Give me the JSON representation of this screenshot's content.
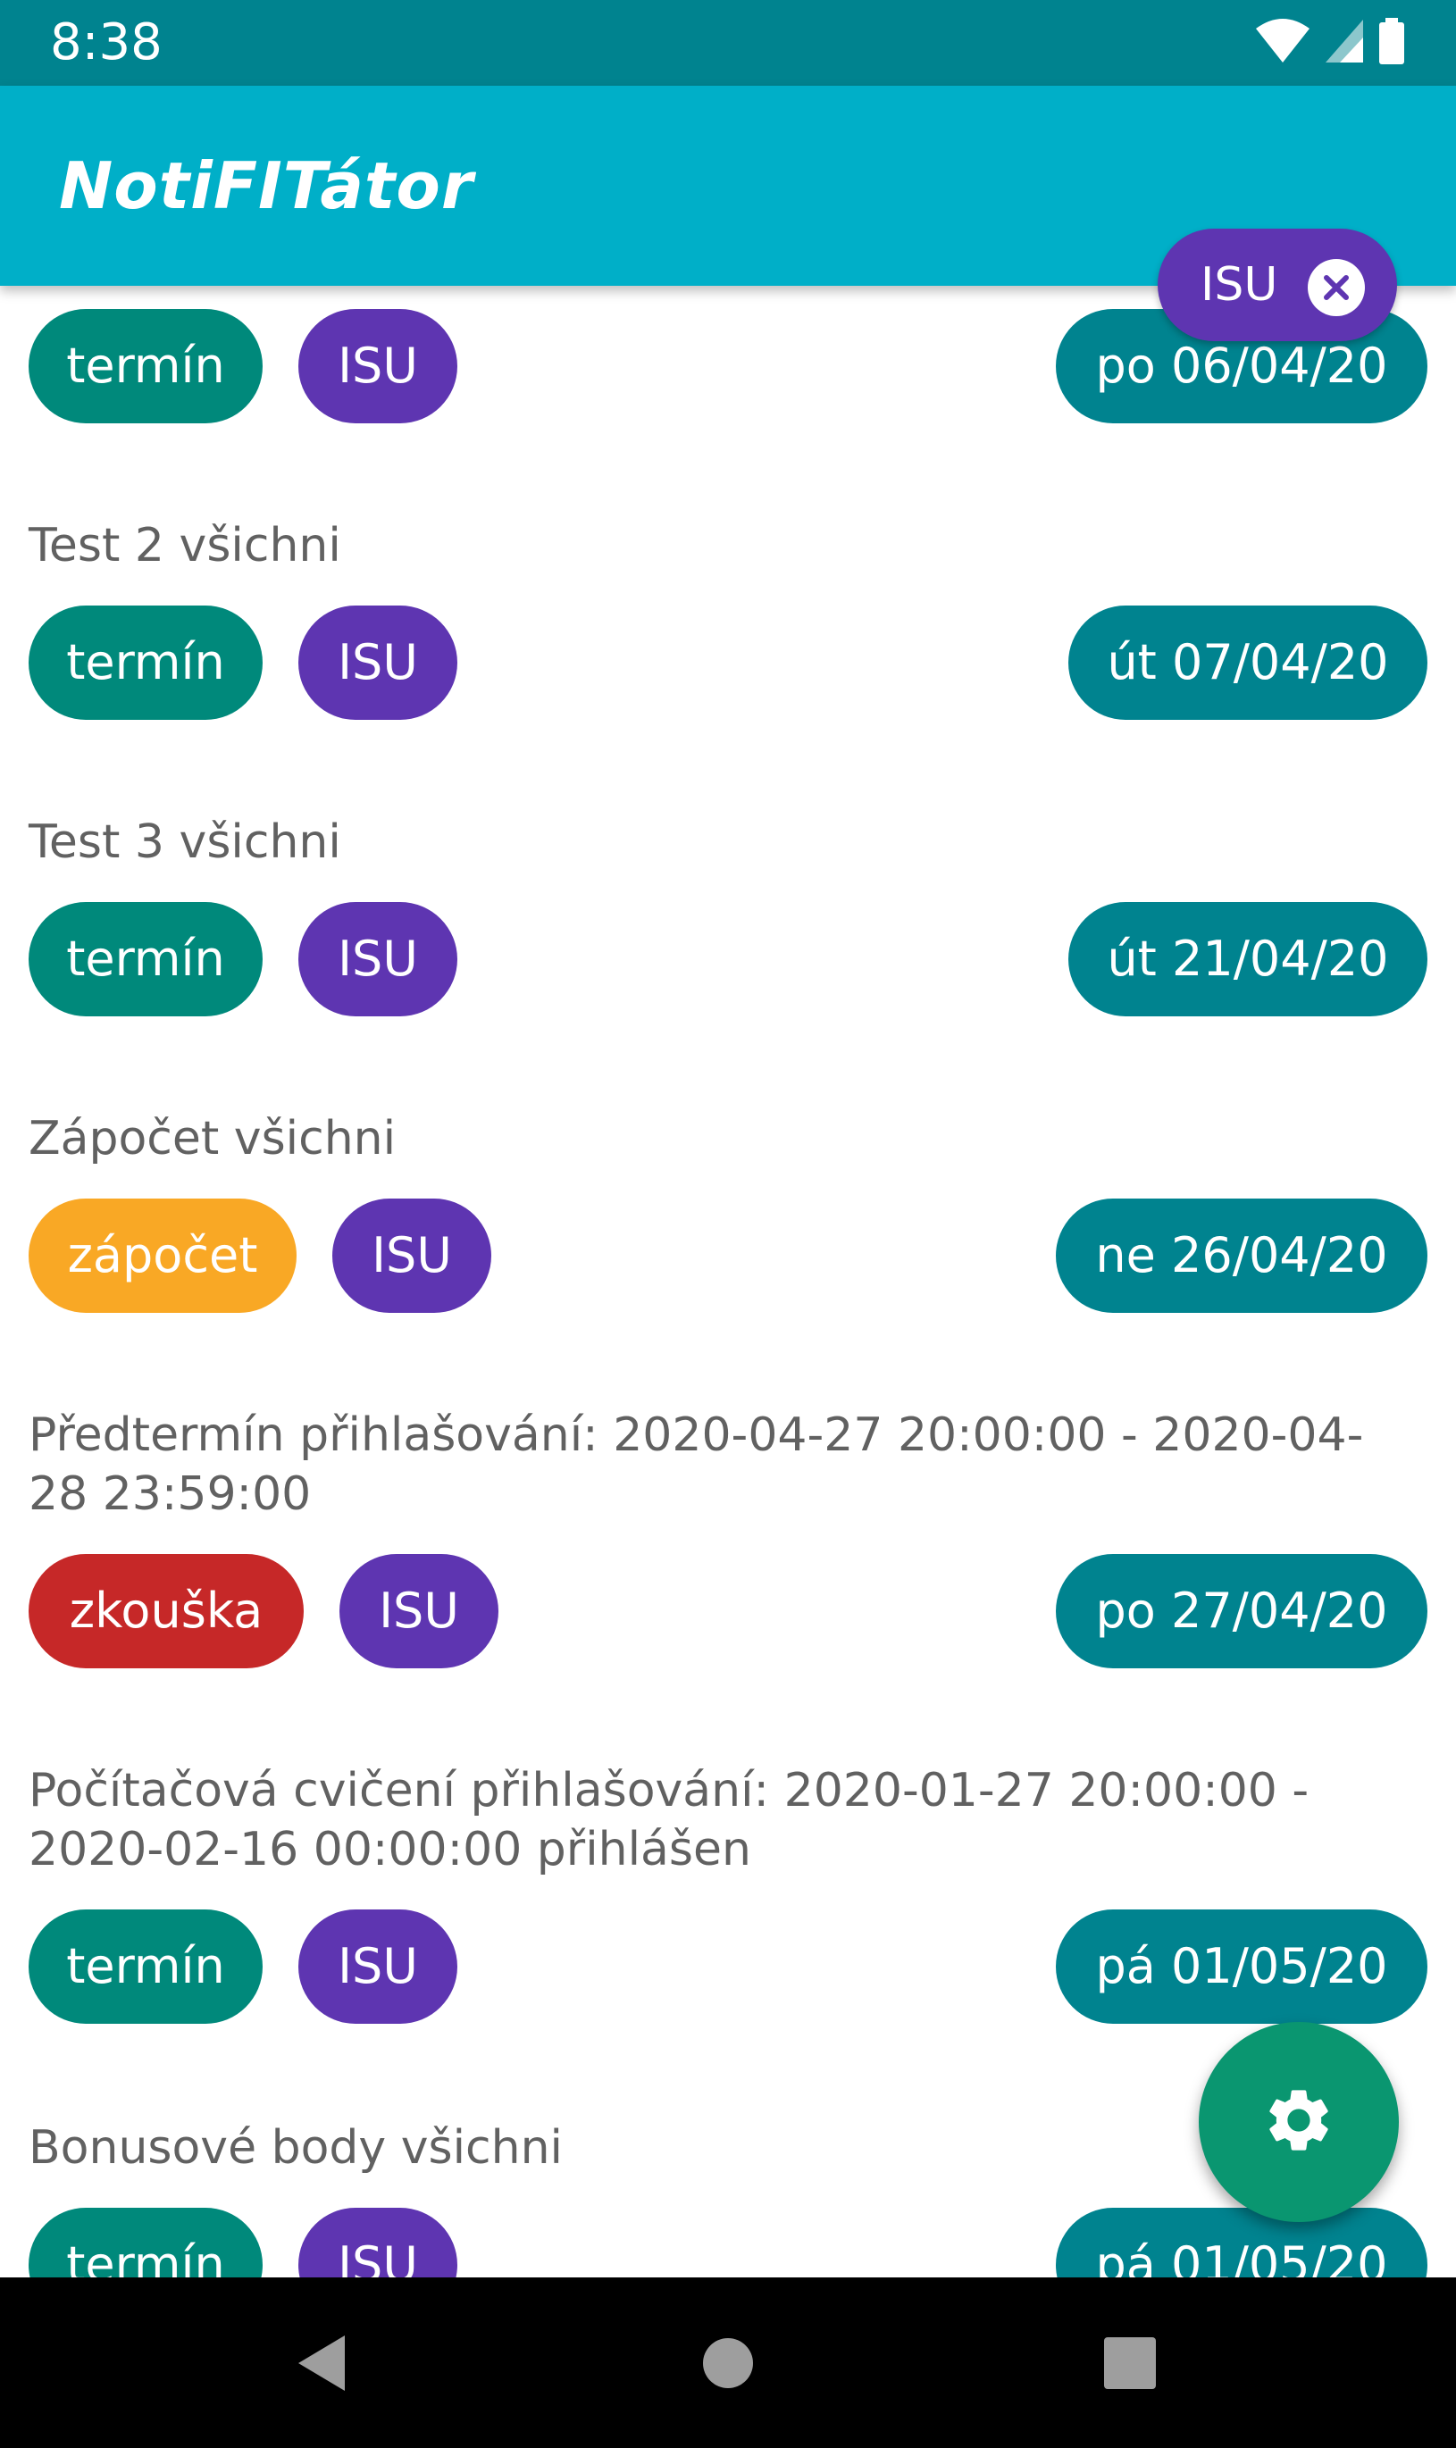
{
  "status_bar": {
    "time": "8:38"
  },
  "app_bar": {
    "title": "NotiFITátor"
  },
  "filter": {
    "label": "ISU"
  },
  "colors": {
    "status_bar": "#00838f",
    "app_bar": "#00afc8",
    "termin": "#00897b",
    "zapocet": "#f9a825",
    "zkouska": "#c62828",
    "isu": "#5e35b1",
    "date": "#00838f",
    "fab": "#0a9670"
  },
  "items": [
    {
      "title": "",
      "type": "termín",
      "type_color": "#00897b",
      "subject": "ISU",
      "date": "po 06/04/20"
    },
    {
      "title": "Test 2 všichni",
      "type": "termín",
      "type_color": "#00897b",
      "subject": "ISU",
      "date": "út 07/04/20"
    },
    {
      "title": "Test 3 všichni",
      "type": "termín",
      "type_color": "#00897b",
      "subject": "ISU",
      "date": "út 21/04/20"
    },
    {
      "title": "Zápočet všichni",
      "type": "zápočet",
      "type_color": "#f9a825",
      "subject": "ISU",
      "date": "ne 26/04/20"
    },
    {
      "title": "Předtermín přihlašování: 2020-04-27 20:00:00 - 2020-04-28 23:59:00",
      "type": "zkouška",
      "type_color": "#c62828",
      "subject": "ISU",
      "date": "po 27/04/20"
    },
    {
      "title": "Počítačová cvičení přihlašování: 2020-01-27 20:00:00 - 2020-02-16 00:00:00 přihlášen",
      "type": "termín",
      "type_color": "#00897b",
      "subject": "ISU",
      "date": "pá 01/05/20"
    },
    {
      "title": "Bonusové body všichni",
      "type": "termín",
      "type_color": "#00897b",
      "subject": "ISU",
      "date": "pá 01/05/20"
    }
  ],
  "icons": {
    "fab": "gear-icon",
    "filter_close": "close-icon",
    "nav": [
      "back-icon",
      "home-icon",
      "recents-icon"
    ],
    "status": [
      "wifi-icon",
      "cell-signal-icon",
      "battery-icon"
    ]
  }
}
